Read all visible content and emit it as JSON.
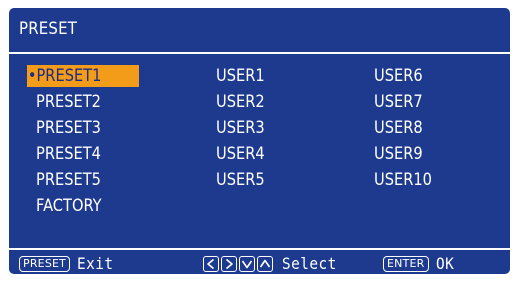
{
  "header": {
    "title": "PRESET"
  },
  "presets": {
    "bullet": "•",
    "items": [
      "PRESET1",
      "PRESET2",
      "PRESET3",
      "PRESET4",
      "PRESET5",
      "FACTORY"
    ],
    "selected_index": 0
  },
  "users": {
    "column1": [
      "USER1",
      "USER2",
      "USER3",
      "USER4",
      "USER5"
    ],
    "column2": [
      "USER6",
      "USER7",
      "USER8",
      "USER9",
      "USER10"
    ]
  },
  "footer": {
    "exit": {
      "key": "PRESET",
      "label": "Exit"
    },
    "select": {
      "keys": [
        "left-arrow",
        "right-arrow",
        "down-arrow",
        "up-arrow"
      ],
      "label": "Select"
    },
    "ok": {
      "key": "ENTER",
      "label": "OK"
    }
  },
  "colors": {
    "background": "#1d3a8f",
    "highlight": "#f39c19",
    "text": "#ffffff",
    "selected_text": "#1e2b86"
  }
}
